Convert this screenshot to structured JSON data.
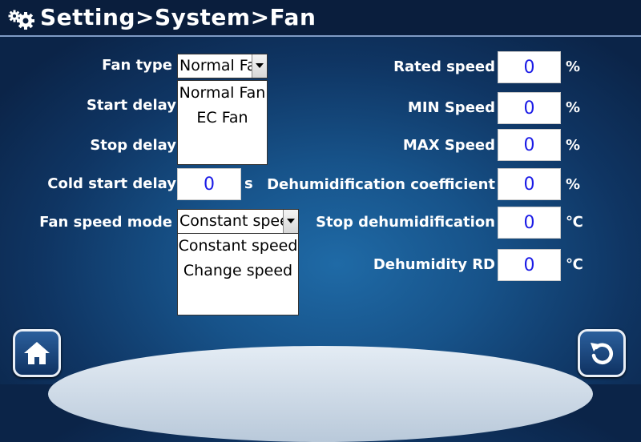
{
  "header": {
    "title": "Setting>System>Fan",
    "icon": "gears-icon"
  },
  "left": {
    "fan_type": {
      "label": "Fan type",
      "selected": "Normal Fa",
      "options": [
        "Normal Fan",
        "EC Fan"
      ]
    },
    "start_delay": {
      "label": "Start delay"
    },
    "stop_delay": {
      "label": "Stop delay"
    },
    "cold_start_delay": {
      "label": "Cold start delay",
      "value": "0",
      "unit": "s"
    },
    "fan_speed_mode": {
      "label": "Fan speed mode",
      "selected": "Constant spee",
      "options": [
        "Constant speed",
        "Change speed"
      ]
    }
  },
  "right": {
    "rated_speed": {
      "label": "Rated speed",
      "value": "0",
      "unit": "%"
    },
    "min_speed": {
      "label": "MIN Speed",
      "value": "0",
      "unit": "%"
    },
    "max_speed": {
      "label": "MAX Speed",
      "value": "0",
      "unit": "%"
    },
    "dehum_coeff": {
      "label": "Dehumidification coefficient",
      "value": "0",
      "unit": "%"
    },
    "stop_dehum": {
      "label": "Stop dehumidification",
      "value": "0",
      "unit": "℃"
    },
    "dehum_rd": {
      "label": "Dehumidity RD",
      "value": "0",
      "unit": "℃"
    }
  },
  "nav": {
    "home_icon": "home-icon",
    "back_icon": "back-icon"
  },
  "colors": {
    "value_text": "#1a1ae6",
    "title_bar": "#0a1e3d"
  }
}
